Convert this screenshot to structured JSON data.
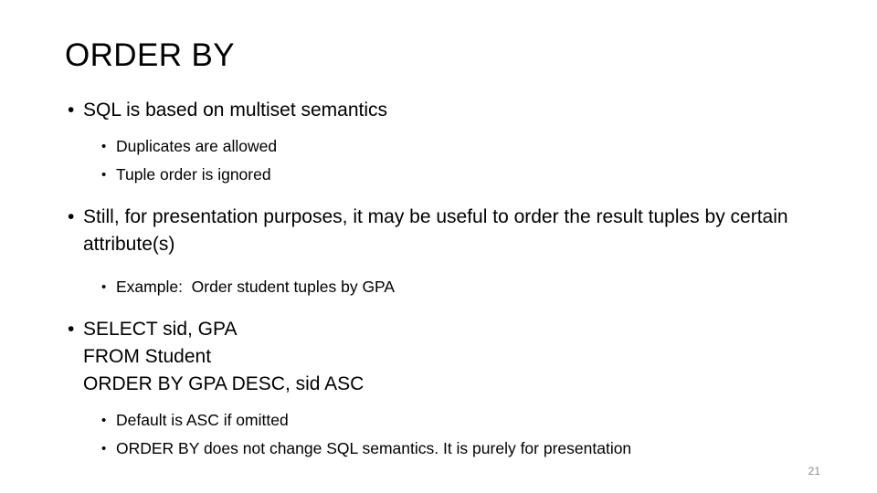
{
  "slide": {
    "title": "ORDER BY",
    "number": "21",
    "bullet_glyph": "•",
    "groups": [
      {
        "name": "multiset-semantics",
        "level1": [
          "SQL is based on multiset semantics"
        ],
        "level2": [
          "Duplicates are allowed",
          "Tuple order is ignored"
        ]
      },
      {
        "name": "presentation-ordering",
        "level1": [
          "Still, for presentation purposes, it may be useful to order the result tuples by certain attribute(s)"
        ],
        "level2": [
          "Example:  Order student tuples by GPA"
        ]
      },
      {
        "name": "query-example",
        "level1": [
          "SELECT sid, GPA\nFROM Student\nORDER BY GPA DESC, sid ASC"
        ],
        "level2": [
          "Default is ASC if omitted",
          "ORDER BY does not change SQL semantics. It is purely for presentation"
        ]
      }
    ]
  }
}
